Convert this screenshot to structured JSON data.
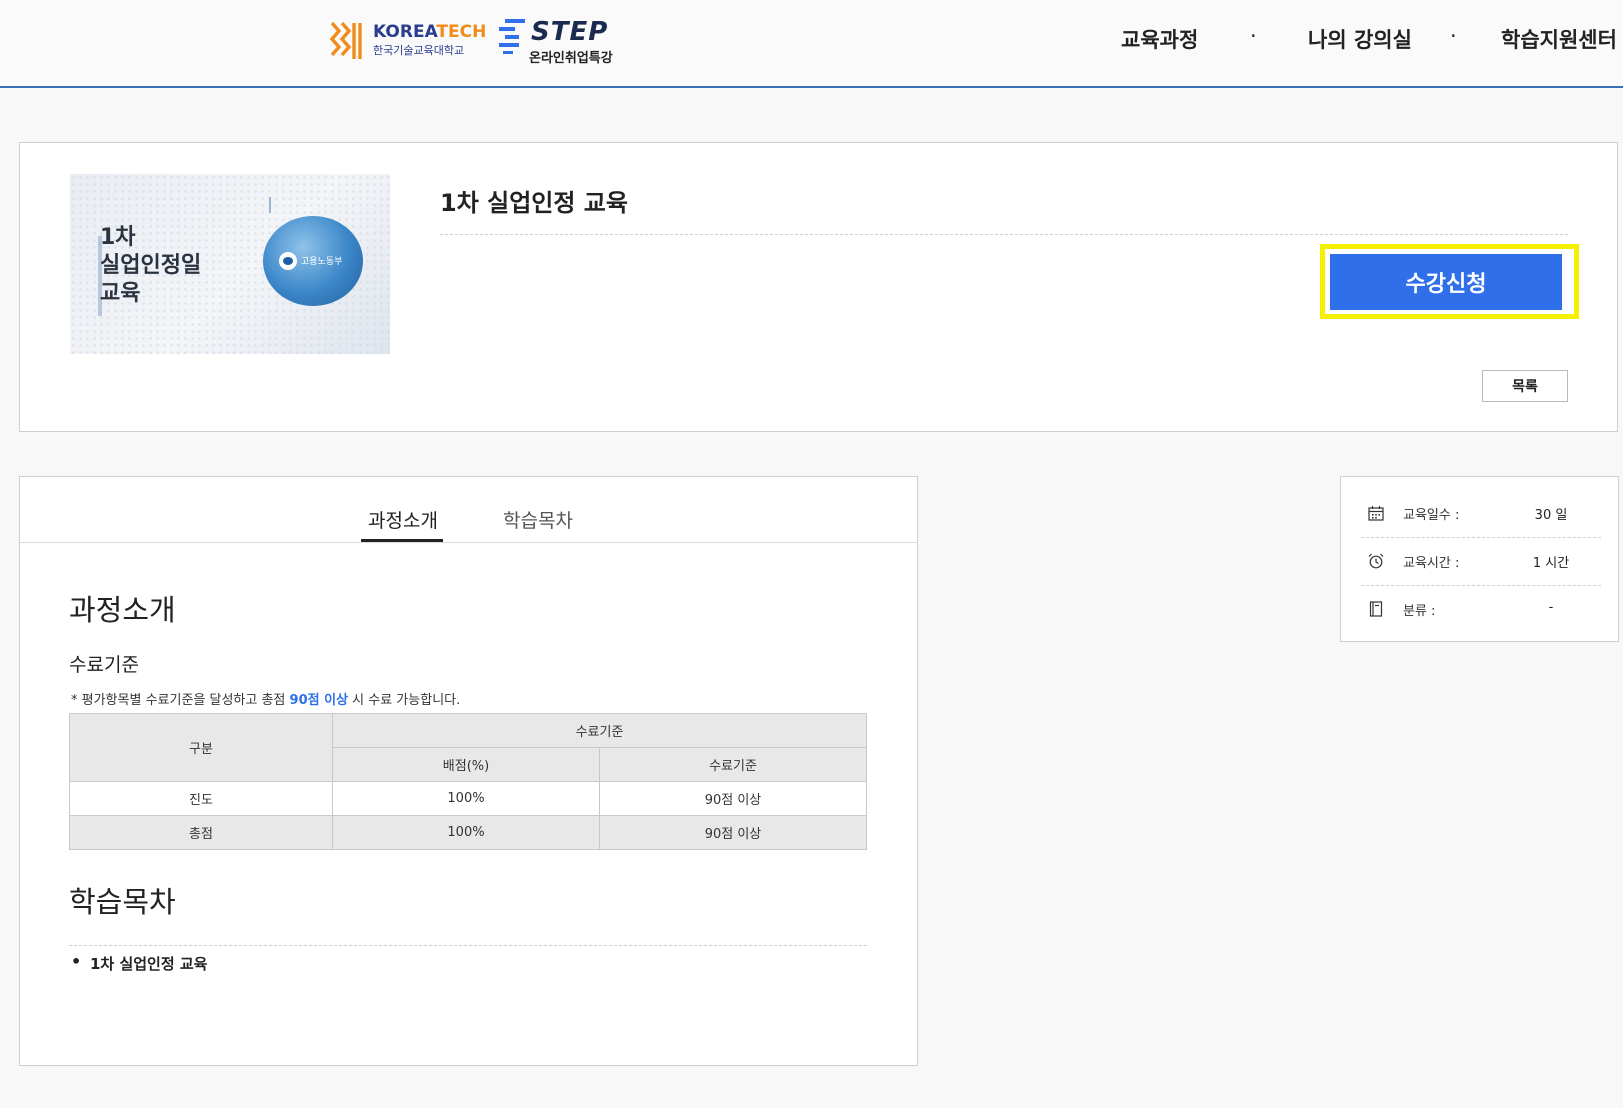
{
  "header": {
    "logo_koreatech": {
      "name_a": "KOREA",
      "name_b": "TECH",
      "subtitle": "한국기술교육대학교"
    },
    "logo_step": {
      "name": "STEP",
      "subtitle": "온라인취업특강"
    },
    "nav": [
      {
        "label": "교육과정"
      },
      {
        "label": "나의 강의실"
      },
      {
        "label": "학습지원센터"
      }
    ],
    "separator": "·"
  },
  "course": {
    "thumbnail_text": "1차\n실업인정일\n교육",
    "thumbnail_badge": "고용노동부",
    "title": "1차 실업인정 교육",
    "enroll_label": "수강신청",
    "list_label": "목록"
  },
  "detail": {
    "tabs": [
      {
        "label": "과정소개",
        "active": true
      },
      {
        "label": "학습목차",
        "active": false
      }
    ],
    "intro_heading": "과정소개",
    "criteria_heading": "수료기준",
    "note_prefix": "* 평가항목별 수료기준을 달성하고 총점 ",
    "note_highlight": "90점 이상",
    "note_suffix": " 시 수료 가능합니다.",
    "table": {
      "col_division": "구분",
      "col_group": "수료기준",
      "col_weight": "배점(%)",
      "col_criteria": "수료기준",
      "rows": [
        {
          "division": "진도",
          "weight": "100%",
          "criteria": "90점 이상"
        },
        {
          "division": "총점",
          "weight": "100%",
          "criteria": "90점 이상"
        }
      ]
    },
    "toc_heading": "학습목차",
    "toc_items": [
      "1차 실업인정 교육"
    ]
  },
  "info": {
    "rows": [
      {
        "icon": "calendar-icon",
        "label": "교육일수 :",
        "value": "30 일"
      },
      {
        "icon": "alarm-clock-icon",
        "label": "교육시간 :",
        "value": "1 시간"
      },
      {
        "icon": "book-icon",
        "label": "분류 :",
        "value": "-"
      }
    ]
  },
  "colors": {
    "accent": "#2f6fea",
    "highlight_frame": "#f5ef00",
    "header_border": "#3a6fb5"
  }
}
